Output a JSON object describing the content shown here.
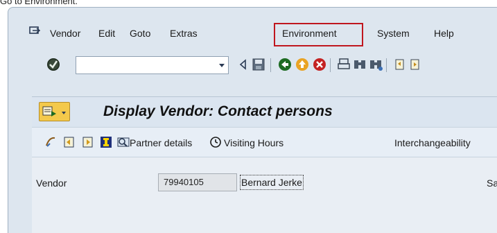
{
  "caption": "Go to Environment.",
  "menubar": {
    "items": [
      {
        "label": "Vendor"
      },
      {
        "label": "Edit"
      },
      {
        "label": "Goto"
      },
      {
        "label": "Extras"
      },
      {
        "label": "Environment"
      },
      {
        "label": "System"
      },
      {
        "label": "Help"
      }
    ],
    "highlighted": "Environment",
    "highlight_color": "#c0161e"
  },
  "toolbar": {
    "command_field": {
      "value": "",
      "placeholder": ""
    },
    "icons": [
      "enter-check-icon",
      "dropdown-arrow-icon",
      "collapse-triangle-icon",
      "save-icon",
      "back-icon",
      "exit-icon",
      "cancel-icon",
      "print-icon",
      "find-icon",
      "find-next-icon",
      "first-page-icon",
      "previous-page-icon"
    ]
  },
  "title": {
    "text": "Display Vendor: Contact persons",
    "menu_button_color": "#f4c94b"
  },
  "app_toolbar": {
    "icons": [
      "other-object-icon",
      "previous-entry-icon",
      "next-entry-icon",
      "information-icon"
    ],
    "buttons": [
      {
        "label": "Partner details",
        "icon": "partner-details-icon"
      },
      {
        "label": "Visiting Hours",
        "icon": "clock-icon"
      },
      {
        "label": "Interchangeability",
        "icon": ""
      }
    ]
  },
  "content": {
    "vendor_label": "Vendor",
    "vendor_number": "79940105",
    "vendor_name": "Bernard Jerke",
    "right_label": "Sai"
  }
}
